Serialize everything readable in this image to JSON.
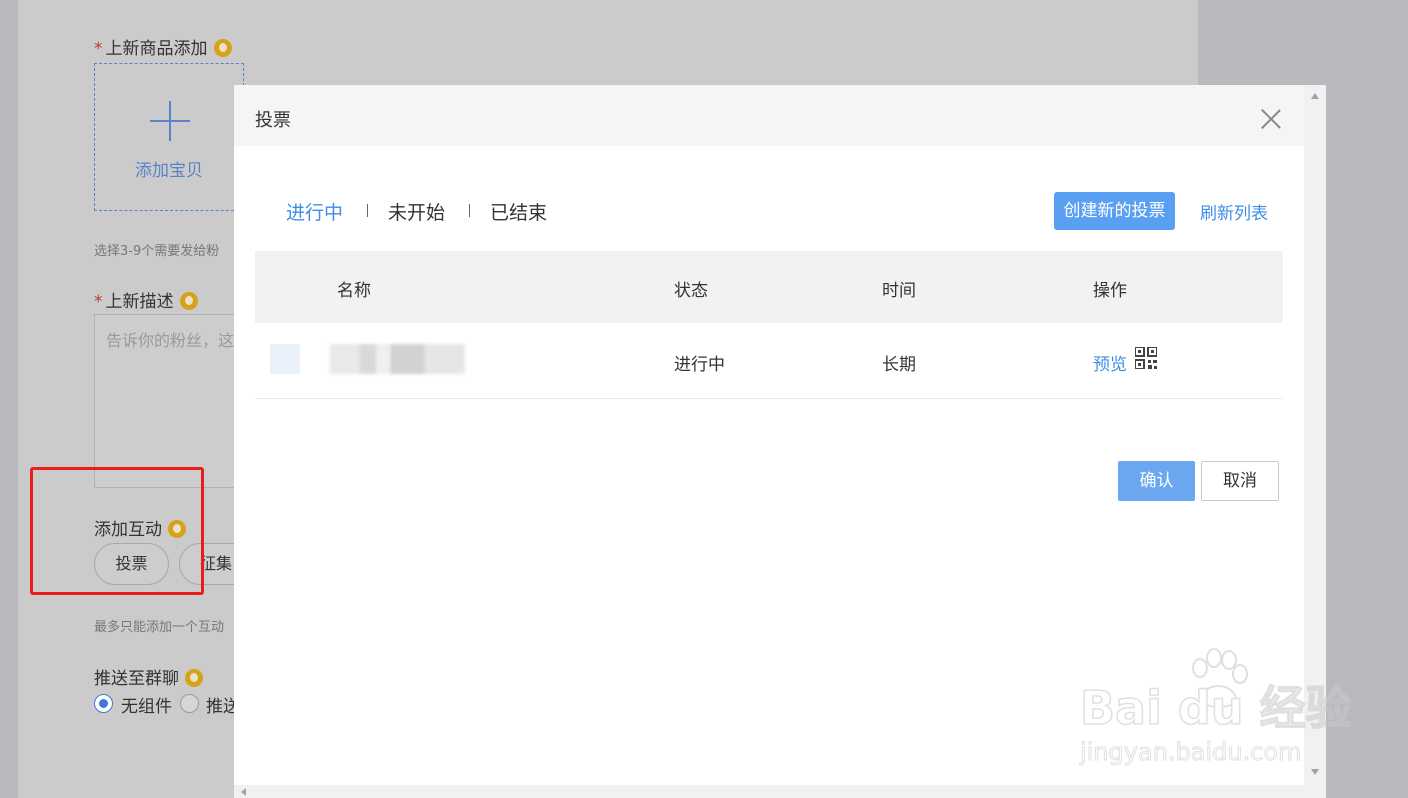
{
  "background": {
    "new_product_label": "上新商品添加",
    "add_item_text": "添加宝贝",
    "select_hint": "选择3-9个需要发给粉",
    "desc_label": "上新描述",
    "desc_placeholder": "告诉你的粉丝，这",
    "interaction_label": "添加互动",
    "interaction_buttons": [
      "投票",
      "征集"
    ],
    "interaction_hint": "最多只能添加一个互动",
    "push_label": "推送至群聊",
    "push_options": [
      "无组件",
      "推送"
    ],
    "push_selected": "无组件",
    "required_mark": "*"
  },
  "modal": {
    "title": "投票",
    "tabs": [
      {
        "label": "进行中",
        "active": true
      },
      {
        "label": "未开始",
        "active": false
      },
      {
        "label": "已结束",
        "active": false
      }
    ],
    "create_button": "创建新的投票",
    "refresh_link": "刷新列表",
    "table": {
      "headers": [
        "名称",
        "状态",
        "时间",
        "操作"
      ],
      "rows": [
        {
          "name": "",
          "status": "进行中",
          "time": "长期",
          "action": "预览"
        }
      ]
    },
    "confirm_button": "确认",
    "cancel_button": "取消"
  },
  "watermark": {
    "brand": "Bai du 经验",
    "url": "jingyan.baidu.com"
  },
  "colors": {
    "accent": "#3e8ee8",
    "primary_button": "#5aa0f2",
    "highlight_frame": "#ea1d1d",
    "tip_icon": "#d6a21a"
  }
}
